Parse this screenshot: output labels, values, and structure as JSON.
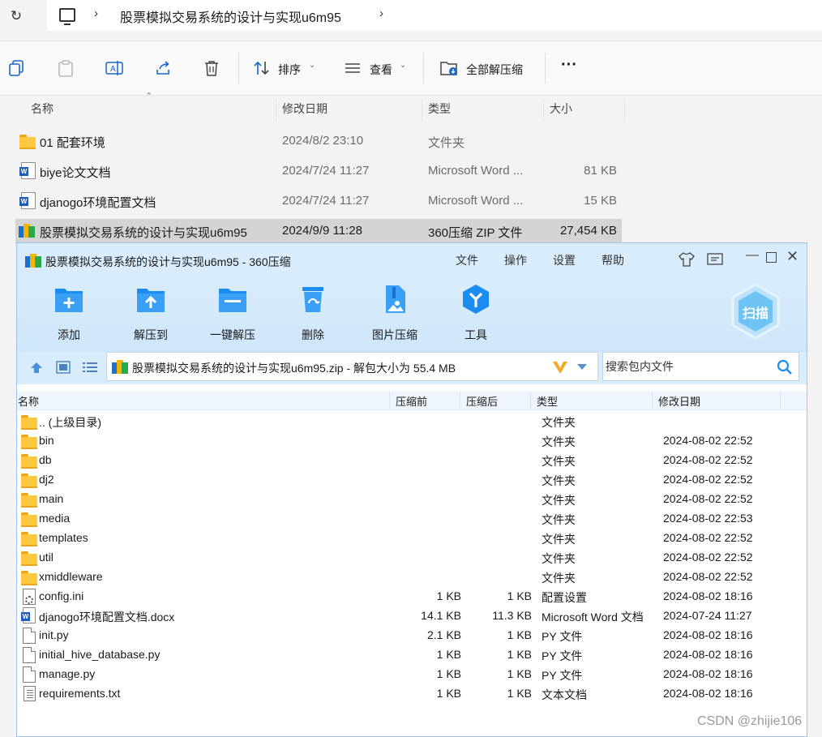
{
  "explorer": {
    "path": "股票模拟交易系统的设计与实现u6m95",
    "toolbar": {
      "sort_label": "排序",
      "view_label": "查看",
      "extract_all_label": "全部解压缩",
      "more_label": "···"
    },
    "columns": {
      "name": "名称",
      "date": "修改日期",
      "type": "类型",
      "size": "大小"
    },
    "rows": [
      {
        "name": "01 配套环境",
        "date": "2024/8/2 23:10",
        "type": "文件夹",
        "size": "",
        "icon": "folder-icon"
      },
      {
        "name": "biye论文文档",
        "date": "2024/7/24 11:27",
        "type": "Microsoft Word ...",
        "size": "81 KB",
        "icon": "word-doc-icon"
      },
      {
        "name": "djanogo环境配置文档",
        "date": "2024/7/24 11:27",
        "type": "Microsoft Word ...",
        "size": "15 KB",
        "icon": "word-doc-icon"
      },
      {
        "name": "股票模拟交易系统的设计与实现u6m95",
        "date": "2024/9/9 11:28",
        "type": "360压缩 ZIP 文件",
        "size": "27,454 KB",
        "icon": "zip-archive-icon"
      }
    ]
  },
  "zip_window": {
    "title": "股票模拟交易系统的设计与实现u6m95 - 360压缩",
    "menu": [
      "文件",
      "操作",
      "设置",
      "帮助"
    ],
    "tools": [
      "添加",
      "解压到",
      "一键解压",
      "删除",
      "图片压缩",
      "工具"
    ],
    "scan_label": "扫描",
    "path_text": "股票模拟交易系统的设计与实现u6m95.zip - 解包大小为 55.4 MB",
    "search_placeholder": "搜索包内文件",
    "columns": {
      "name": "名称",
      "before": "压缩前",
      "after": "压缩后",
      "type": "类型",
      "date": "修改日期"
    },
    "rows": [
      {
        "name": ".. (上级目录)",
        "before": "",
        "after": "",
        "type": "文件夹",
        "date": "",
        "icon": "folder-icon"
      },
      {
        "name": "bin",
        "before": "",
        "after": "",
        "type": "文件夹",
        "date": "2024-08-02 22:52",
        "icon": "folder-icon"
      },
      {
        "name": "db",
        "before": "",
        "after": "",
        "type": "文件夹",
        "date": "2024-08-02 22:52",
        "icon": "folder-icon"
      },
      {
        "name": "dj2",
        "before": "",
        "after": "",
        "type": "文件夹",
        "date": "2024-08-02 22:52",
        "icon": "folder-icon"
      },
      {
        "name": "main",
        "before": "",
        "after": "",
        "type": "文件夹",
        "date": "2024-08-02 22:52",
        "icon": "folder-icon"
      },
      {
        "name": "media",
        "before": "",
        "after": "",
        "type": "文件夹",
        "date": "2024-08-02 22:53",
        "icon": "folder-icon"
      },
      {
        "name": "templates",
        "before": "",
        "after": "",
        "type": "文件夹",
        "date": "2024-08-02 22:52",
        "icon": "folder-icon"
      },
      {
        "name": "util",
        "before": "",
        "after": "",
        "type": "文件夹",
        "date": "2024-08-02 22:52",
        "icon": "folder-icon"
      },
      {
        "name": "xmiddleware",
        "before": "",
        "after": "",
        "type": "文件夹",
        "date": "2024-08-02 22:52",
        "icon": "folder-icon"
      },
      {
        "name": "config.ini",
        "before": "1 KB",
        "after": "1 KB",
        "type": "配置设置",
        "date": "2024-08-02 18:16",
        "icon": "config-file-icon"
      },
      {
        "name": "djanogo环境配置文档.docx",
        "before": "14.1 KB",
        "after": "11.3 KB",
        "type": "Microsoft Word 文档",
        "date": "2024-07-24 11:27",
        "icon": "word-doc-icon"
      },
      {
        "name": "init.py",
        "before": "2.1 KB",
        "after": "1 KB",
        "type": "PY 文件",
        "date": "2024-08-02 18:16",
        "icon": "file-icon"
      },
      {
        "name": "initial_hive_database.py",
        "before": "1 KB",
        "after": "1 KB",
        "type": "PY 文件",
        "date": "2024-08-02 18:16",
        "icon": "file-icon"
      },
      {
        "name": "manage.py",
        "before": "1 KB",
        "after": "1 KB",
        "type": "PY 文件",
        "date": "2024-08-02 18:16",
        "icon": "file-icon"
      },
      {
        "name": "requirements.txt",
        "before": "1 KB",
        "after": "1 KB",
        "type": "文本文档",
        "date": "2024-08-02 18:16",
        "icon": "text-file-icon"
      }
    ]
  },
  "watermark": "CSDN @zhijie106",
  "colors": {
    "accent": "#1b8cf0",
    "window_chrome": "#d9ecfb",
    "selection": "#d4d4d4",
    "folder": "#ffc83d"
  }
}
